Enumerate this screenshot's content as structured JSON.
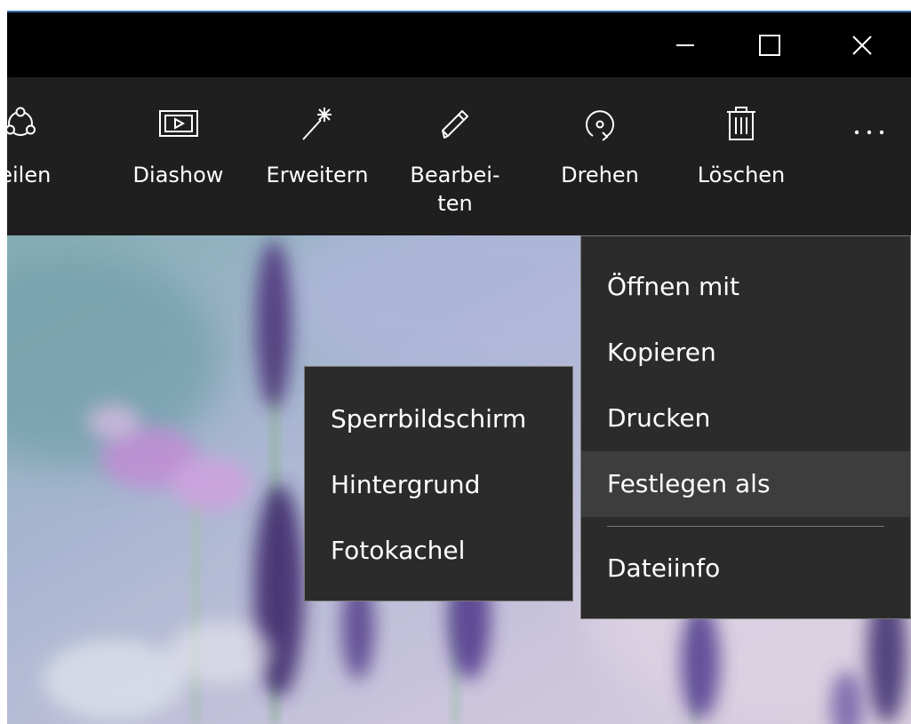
{
  "window": {
    "accent_color": "#3b6ea5",
    "minimize_icon": "minimize-icon",
    "maximize_icon": "maximize-icon",
    "close_icon": "close-icon"
  },
  "toolbar": {
    "items": [
      {
        "label": "Teilen",
        "icon": "share-icon"
      },
      {
        "label": "Diashow",
        "icon": "slideshow-icon"
      },
      {
        "label": "Erweitern",
        "icon": "magic-wand-icon"
      },
      {
        "label": "Bearbei-\nten",
        "icon": "pencil-icon"
      },
      {
        "label": "Drehen",
        "icon": "rotate-icon"
      },
      {
        "label": "Löschen",
        "icon": "trash-icon"
      }
    ],
    "more_icon": "more-icon"
  },
  "context_menu": {
    "items": [
      {
        "label": "Öffnen mit"
      },
      {
        "label": "Kopieren"
      },
      {
        "label": "Drucken"
      },
      {
        "label": "Festlegen als",
        "highlighted": true
      },
      {
        "label": "Dateiinfo"
      }
    ]
  },
  "submenu": {
    "items": [
      {
        "label": "Sperrbildschirm"
      },
      {
        "label": "Hintergrund"
      },
      {
        "label": "Fotokachel"
      }
    ]
  },
  "colors": {
    "menu_bg": "#2b2b2b",
    "menu_hover": "#3d3d3d",
    "toolbar_bg": "#1f1f1f",
    "titlebar_bg": "#000000"
  }
}
